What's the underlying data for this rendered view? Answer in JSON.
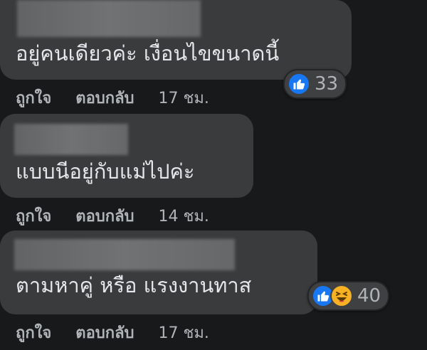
{
  "comments": [
    {
      "text": "อยู่คนเดียวค่ะ เงื่อนไขขนาดนี้",
      "reactions": {
        "icons": [
          "like-icon"
        ],
        "count": "33"
      },
      "actions": {
        "like": "ถูกใจ",
        "reply": "ตอบกลับ",
        "time": "17 ชม."
      }
    },
    {
      "text": "แบบนีอยู่กับแม่ไปค่ะ",
      "reactions": null,
      "actions": {
        "like": "ถูกใจ",
        "reply": "ตอบกลับ",
        "time": "14 ชม."
      }
    },
    {
      "text": "ตามหาคู่ หรือ แรงงานทาส",
      "reactions": {
        "icons": [
          "like-icon",
          "haha-icon"
        ],
        "count": "40"
      },
      "actions": {
        "like": "ถูกใจ",
        "reply": "ตอบกลับ",
        "time": "17 ชม."
      }
    }
  ],
  "colors": {
    "background": "#18191a",
    "bubble": "#3a3b3c",
    "text": "#e4e6eb",
    "meta": "#b0b3b8",
    "like_blue": "#1877f2",
    "haha_yellow": "#f7b125"
  }
}
